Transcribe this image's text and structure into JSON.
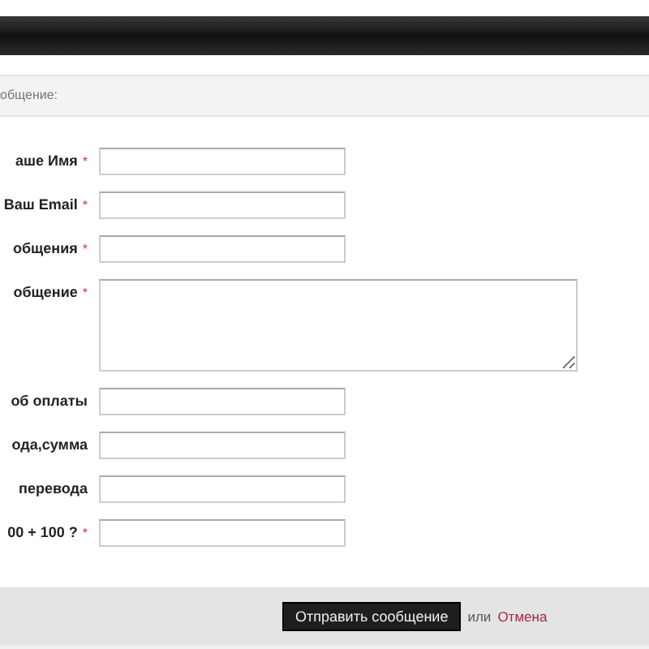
{
  "section_title": "общение:",
  "fields": [
    {
      "kind": "input",
      "label": "аше Имя",
      "required_mark": "*"
    },
    {
      "kind": "input",
      "label": "Ваш Email",
      "required_mark": "*"
    },
    {
      "kind": "input",
      "label": "общения",
      "required_mark": "*"
    },
    {
      "kind": "textarea",
      "label": "общение",
      "required_mark": "*"
    },
    {
      "kind": "input",
      "label": "об оплаты"
    },
    {
      "kind": "input",
      "label": "ода,сумма"
    },
    {
      "kind": "input",
      "label": "перевода"
    },
    {
      "kind": "input",
      "label": "00 + 100 ?",
      "required_mark": "*"
    }
  ],
  "submit_button": "Отправить сообщение",
  "or_text": "или",
  "cancel_link": "Отмена"
}
